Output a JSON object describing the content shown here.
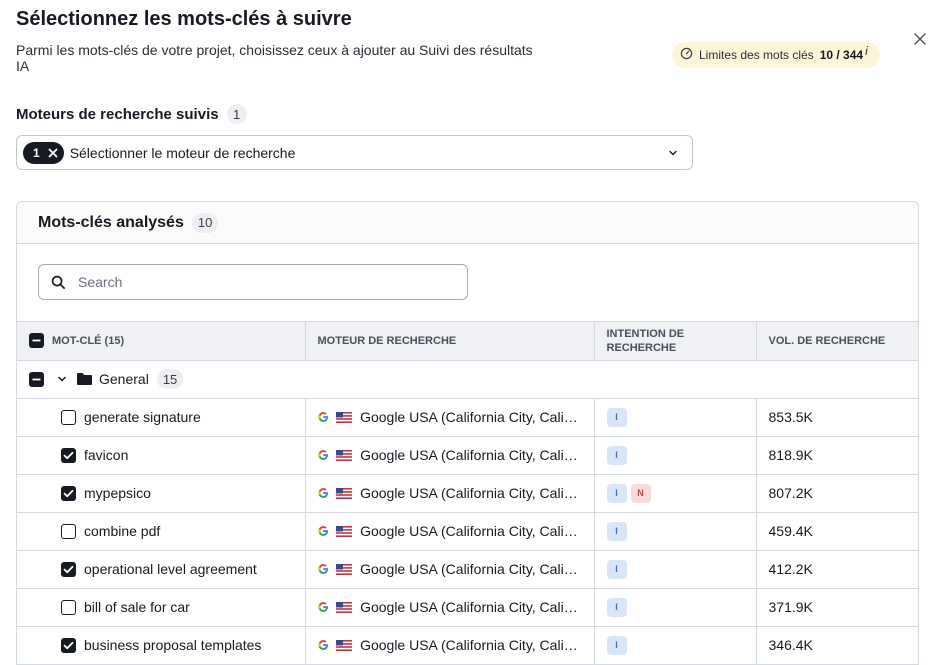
{
  "dialog": {
    "title": "Sélectionnez les mots-clés à suivre",
    "subtitle": "Parmi les mots-clés de votre projet, choisissez ceux à ajouter au Suivi des résultats IA",
    "limits_label": "Limites des mots clés",
    "limits_value": "10 / 344",
    "limits_info": "i"
  },
  "engines": {
    "label": "Moteurs de recherche suivis",
    "count": "1",
    "chip_count": "1",
    "placeholder": "Sélectionner le moteur de recherche"
  },
  "keywords_panel": {
    "title": "Mots-clés analysés",
    "count": "10",
    "search_placeholder": "Search"
  },
  "table": {
    "columns": {
      "keyword": "MOT-CLÉ (15)",
      "engine": "MOTEUR DE RECHERCHE",
      "intent": "INTENTION DE RECHERCHE",
      "volume": "VOL. DE RECHERCHE"
    },
    "group": {
      "name": "General",
      "count": "15"
    },
    "rows": [
      {
        "keyword": "generate signature",
        "checked": false,
        "engine": "Google USA (California City, California, United States)",
        "intents": [
          "I"
        ],
        "volume": "853.5K"
      },
      {
        "keyword": "favicon",
        "checked": true,
        "engine": "Google USA (California City, California, United States)",
        "intents": [
          "I"
        ],
        "volume": "818.9K"
      },
      {
        "keyword": "mypepsico",
        "checked": true,
        "engine": "Google USA (California City, California, United States)",
        "intents": [
          "I",
          "N"
        ],
        "volume": "807.2K"
      },
      {
        "keyword": "combine pdf",
        "checked": false,
        "engine": "Google USA (California City, California, United States)",
        "intents": [
          "I"
        ],
        "volume": "459.4K"
      },
      {
        "keyword": "operational level agreement",
        "checked": true,
        "engine": "Google USA (California City, California, United States)",
        "intents": [
          "I"
        ],
        "volume": "412.2K"
      },
      {
        "keyword": "bill of sale for car",
        "checked": false,
        "engine": "Google USA (California City, California, United States)",
        "intents": [
          "I"
        ],
        "volume": "371.9K"
      },
      {
        "keyword": "business proposal templates",
        "checked": true,
        "engine": "Google USA (California City, California, United States)",
        "intents": [
          "I"
        ],
        "volume": "346.4K"
      }
    ]
  },
  "colors": {
    "accent_dark": "#171a22",
    "limits_bg": "#fdf6d6",
    "intent_informational": "#d9e6f7",
    "intent_navigational": "#fadbdb"
  }
}
